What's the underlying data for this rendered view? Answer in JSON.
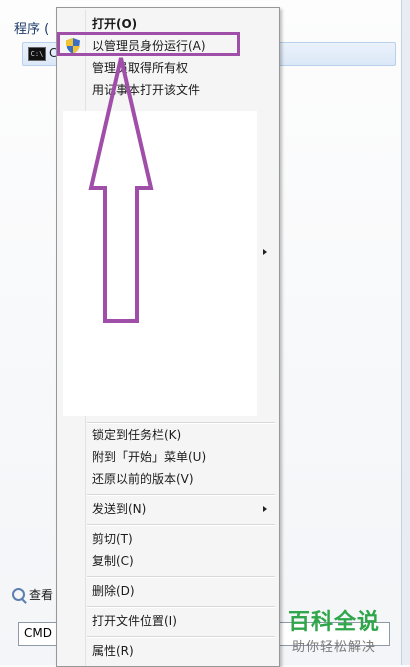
{
  "start_panel": {
    "section_title": "程序 (",
    "program_item": "C",
    "program_icon_text": "C:\\",
    "search_all_label": "查看",
    "search_value": "CMD",
    "search_placeholder": ""
  },
  "context_menu": {
    "items": [
      {
        "label": "打开(O)",
        "bold": true
      },
      {
        "label": "以管理员身份运行(A)",
        "icon": "uac-shield-icon"
      },
      {
        "label": "管理员取得所有权"
      },
      {
        "label": "用记事本打开该文件"
      },
      {
        "label": "锁定到任务栏(K)"
      },
      {
        "label": "附到「开始」菜单(U)"
      },
      {
        "label": "还原以前的版本(V)"
      },
      {
        "label": "发送到(N)",
        "submenu": true
      },
      {
        "label": "剪切(T)"
      },
      {
        "label": "复制(C)"
      },
      {
        "label": "删除(D)"
      },
      {
        "label": "打开文件位置(I)"
      },
      {
        "label": "属性(R)"
      }
    ]
  },
  "annotation": {
    "highlight_color": "#a04fa8",
    "arrow_color": "#a04fa8"
  },
  "watermark": {
    "title": "百科全说",
    "subtitle": "助你轻松解决",
    "color": "#2fa64a"
  }
}
